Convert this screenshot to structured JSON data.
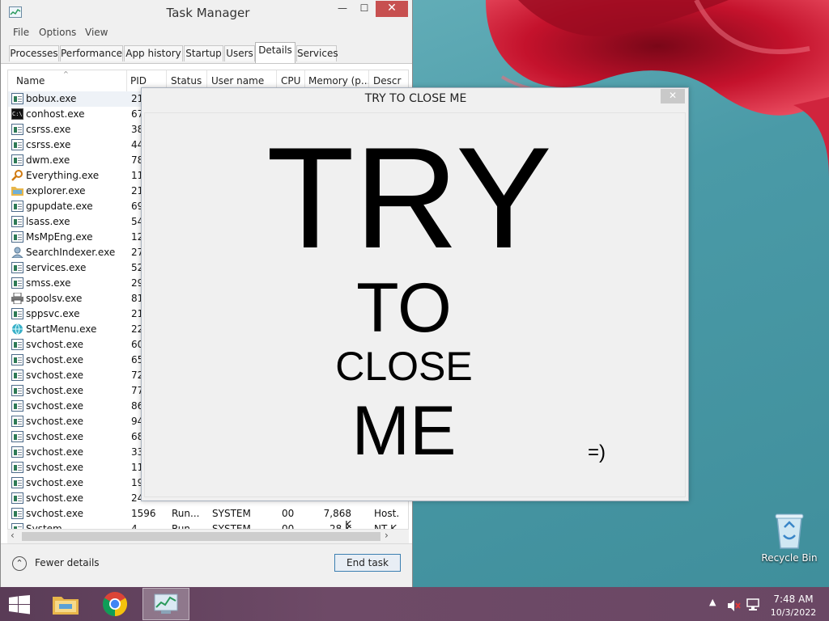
{
  "taskmanager": {
    "title": "Task Manager",
    "menu": [
      "File",
      "Options",
      "View"
    ],
    "tabs": [
      "Processes",
      "Performance",
      "App history",
      "Startup",
      "Users",
      "Details",
      "Services"
    ],
    "active_tab": "Details",
    "columns": [
      "Name",
      "PID",
      "Status",
      "User name",
      "CPU",
      "Memory (p...",
      "Descr"
    ],
    "rows": [
      {
        "name": "bobux.exe",
        "pid": "21",
        "icon": "process-icon"
      },
      {
        "name": "conhost.exe",
        "pid": "67",
        "icon": "console-icon"
      },
      {
        "name": "csrss.exe",
        "pid": "38",
        "icon": "process-icon"
      },
      {
        "name": "csrss.exe",
        "pid": "44",
        "icon": "process-icon"
      },
      {
        "name": "dwm.exe",
        "pid": "78",
        "icon": "process-icon"
      },
      {
        "name": "Everything.exe",
        "pid": "11",
        "icon": "magnifier-icon"
      },
      {
        "name": "explorer.exe",
        "pid": "21",
        "icon": "folder-icon"
      },
      {
        "name": "gpupdate.exe",
        "pid": "69",
        "icon": "process-icon"
      },
      {
        "name": "lsass.exe",
        "pid": "54",
        "icon": "process-icon"
      },
      {
        "name": "MsMpEng.exe",
        "pid": "12",
        "icon": "process-icon"
      },
      {
        "name": "SearchIndexer.exe",
        "pid": "27",
        "icon": "user-icon"
      },
      {
        "name": "services.exe",
        "pid": "52",
        "icon": "process-icon"
      },
      {
        "name": "smss.exe",
        "pid": "29",
        "icon": "process-icon"
      },
      {
        "name": "spoolsv.exe",
        "pid": "81",
        "icon": "printer-icon"
      },
      {
        "name": "sppsvc.exe",
        "pid": "21",
        "icon": "process-icon"
      },
      {
        "name": "StartMenu.exe",
        "pid": "22",
        "icon": "globe-icon"
      },
      {
        "name": "svchost.exe",
        "pid": "60",
        "icon": "process-icon"
      },
      {
        "name": "svchost.exe",
        "pid": "65",
        "icon": "process-icon"
      },
      {
        "name": "svchost.exe",
        "pid": "72",
        "icon": "process-icon"
      },
      {
        "name": "svchost.exe",
        "pid": "77",
        "icon": "process-icon"
      },
      {
        "name": "svchost.exe",
        "pid": "86",
        "icon": "process-icon"
      },
      {
        "name": "svchost.exe",
        "pid": "94",
        "icon": "process-icon"
      },
      {
        "name": "svchost.exe",
        "pid": "68",
        "icon": "process-icon"
      },
      {
        "name": "svchost.exe",
        "pid": "33",
        "icon": "process-icon"
      },
      {
        "name": "svchost.exe",
        "pid": "11",
        "icon": "process-icon"
      },
      {
        "name": "svchost.exe",
        "pid": "19",
        "icon": "process-icon"
      },
      {
        "name": "svchost.exe",
        "pid": "24",
        "icon": "process-icon"
      },
      {
        "name": "svchost.exe",
        "pid": "1596",
        "status": "Run...",
        "user": "SYSTEM",
        "cpu": "00",
        "mem": "7,868 K",
        "desc": "Host.",
        "icon": "process-icon"
      },
      {
        "name": "System",
        "pid": "4",
        "status": "Run...",
        "user": "SYSTEM",
        "cpu": "00",
        "mem": "28 K",
        "desc": "NT K",
        "icon": "process-icon"
      }
    ],
    "fewer_details": "Fewer details",
    "end_task": "End task"
  },
  "prank": {
    "title": "TRY TO CLOSE ME",
    "close_glyph": "✕",
    "words": [
      "TRY",
      "TO",
      "CLOSE",
      "ME"
    ],
    "smiley": "=)"
  },
  "desktop": {
    "recycle_bin": "Recycle Bin"
  },
  "taskbar": {
    "time": "7:48 AM",
    "date": "10/3/2022"
  },
  "colors": {
    "close_red": "#c75050",
    "taskbar": "#6a4764",
    "desktop_teal": "#4a9aa7",
    "flower_red": "#c4122c"
  }
}
